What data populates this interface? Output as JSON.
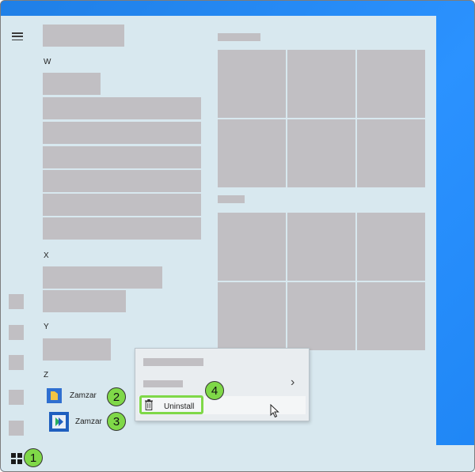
{
  "start_menu": {
    "letters": [
      "W",
      "X",
      "Y",
      "Z"
    ],
    "apps": [
      {
        "label": "Zamzar",
        "icon": "folder-icon"
      },
      {
        "label": "Zamzar",
        "icon": "zamzar-app-icon"
      }
    ]
  },
  "context_menu": {
    "uninstall_label": "Uninstall",
    "submenu_arrow": "›"
  },
  "annotations": [
    "1",
    "2",
    "3",
    "4"
  ],
  "colors": {
    "menu_bg": "#d8e8ef",
    "placeholder_gray": "#c1bfc3",
    "highlight_green": "#7fd848",
    "desktop_blue": "#2b92ff"
  }
}
